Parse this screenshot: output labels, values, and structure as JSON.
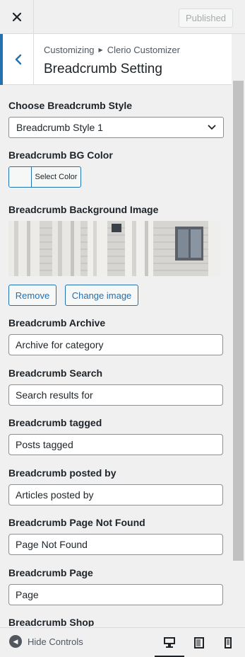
{
  "topbar": {
    "close_icon": "close-icon",
    "publish_label": "Published"
  },
  "section": {
    "breadcrumb_root": "Customizing",
    "breadcrumb_parent": "Clerio Customizer",
    "title": "Breadcrumb Setting",
    "back_icon": "chevron-left-icon"
  },
  "controls": {
    "style_label": "Choose Breadcrumb Style",
    "style_value": "Breadcrumb Style 1",
    "bgcolor_label": "Breadcrumb BG Color",
    "bgcolor_button": "Select Color",
    "bgimage_label": "Breadcrumb Background Image",
    "remove_button": "Remove",
    "change_button": "Change image",
    "archive_label": "Breadcrumb Archive",
    "archive_value": "Archive for category",
    "search_label": "Breadcrumb Search",
    "search_value": "Search results for",
    "tagged_label": "Breadcrumb tagged",
    "tagged_value": "Posts tagged",
    "postedby_label": "Breadcrumb posted by",
    "postedby_value": "Articles posted by",
    "notfound_label": "Breadcrumb Page Not Found",
    "notfound_value": "Page Not Found",
    "page_label": "Breadcrumb Page",
    "page_value": "Page",
    "shop_label": "Breadcrumb Shop"
  },
  "footer": {
    "hide_controls": "Hide Controls",
    "devices": [
      "desktop-icon",
      "tablet-icon",
      "mobile-icon"
    ]
  },
  "colors": {
    "accent": "#2271b1",
    "background": "#f0f0f1"
  }
}
